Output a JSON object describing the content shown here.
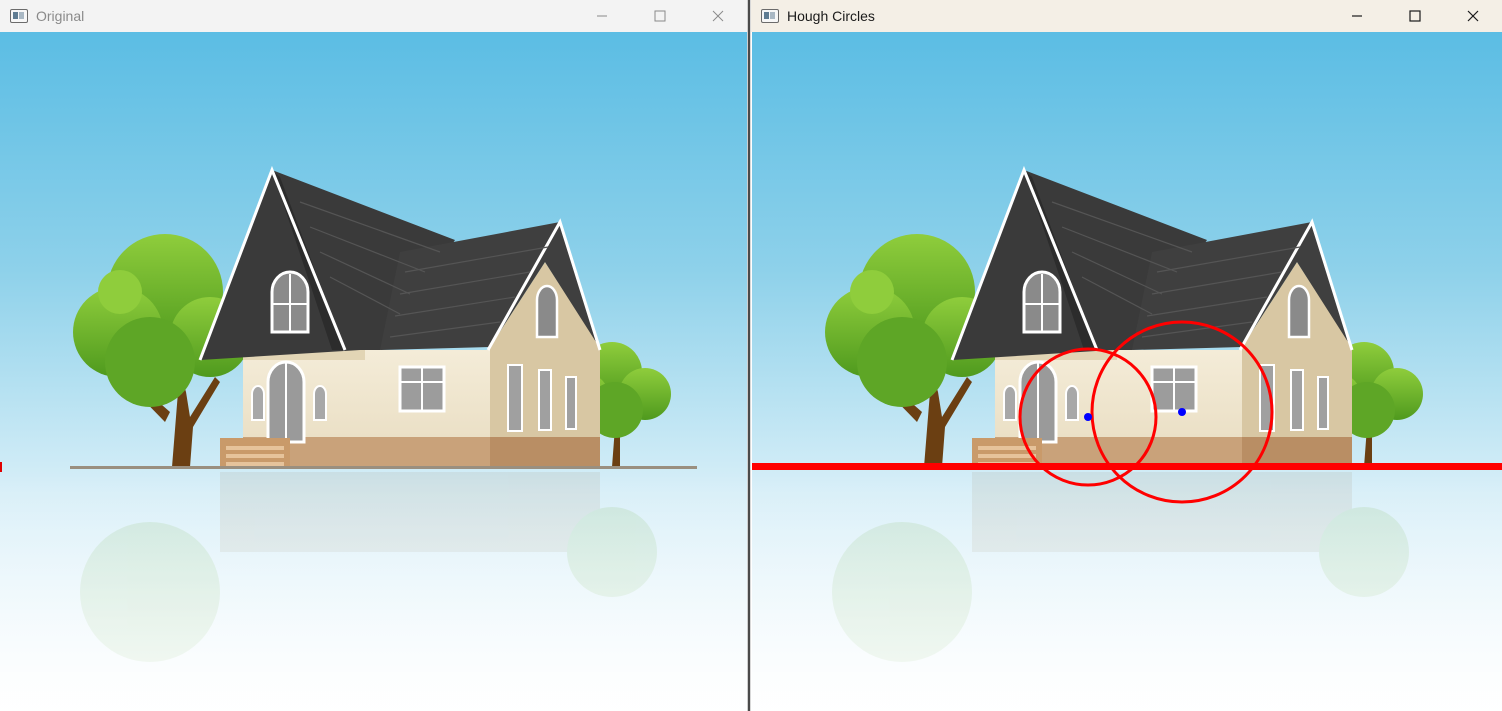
{
  "windows": [
    {
      "id": "original",
      "title": "Original",
      "controls": [
        "minimize",
        "maximize",
        "close"
      ],
      "image": "house-scene"
    },
    {
      "id": "hough",
      "title": "Hough Circles",
      "controls": [
        "minimize",
        "maximize",
        "close"
      ],
      "image": "house-scene-with-detections",
      "overlay": {
        "circle_color": "#ff0000",
        "center_color": "#0000ff",
        "line_color": "#ff0000",
        "detected_circles": 2,
        "detected_lines": 1
      }
    }
  ],
  "colors": {
    "sky_top": "#5bbde4",
    "sky_bottom": "#ffffff",
    "roof": "#3c3c3c",
    "wall": "#efe6cf",
    "wall_shadow": "#d6c39e",
    "tree_leaf": "#79bd2e",
    "tree_trunk": "#6b3f12",
    "ground_line": "#9a8f7f"
  }
}
